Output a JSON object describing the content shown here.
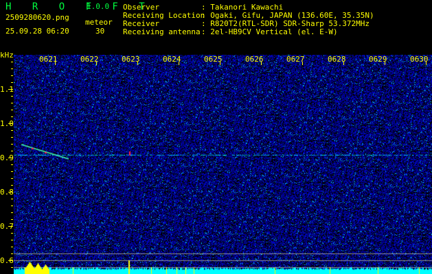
{
  "app": {
    "name": "H R O F F T",
    "version": "1.0.0"
  },
  "file": {
    "name": "2509280620.png",
    "datetime": "25.09.28 06:20"
  },
  "meteor": {
    "label": "meteor",
    "count": "30"
  },
  "info": [
    {
      "label": "Observer",
      "value": ": Takanori Kawachi"
    },
    {
      "label": "Receiving Location",
      "value": ": Ogaki, Gifu, JAPAN (136.60E, 35.35N)"
    },
    {
      "label": "Receiver",
      "value": ": R820T2(RTL-SDR) SDR-Sharp 53.372MHz"
    },
    {
      "label": "Receiving antenna",
      "value": ": 2el-HB9CV Vertical (el. E-W)"
    }
  ],
  "axis": {
    "y_unit": "kHz",
    "y_labels": [
      "1.1",
      "1.0",
      "0.9",
      "0.8",
      "0.7",
      "0.6"
    ],
    "x_labels": [
      "0621",
      "0622",
      "0623",
      "0624",
      "0625",
      "0626",
      "0627",
      "0628",
      "0629",
      "0630"
    ]
  },
  "colors": {
    "text": "#ffff00",
    "title": "#00ff40",
    "noise": "#0010c0",
    "carrier": "#00ffff",
    "level": "#00ffff",
    "peak": "#ffff00"
  }
}
